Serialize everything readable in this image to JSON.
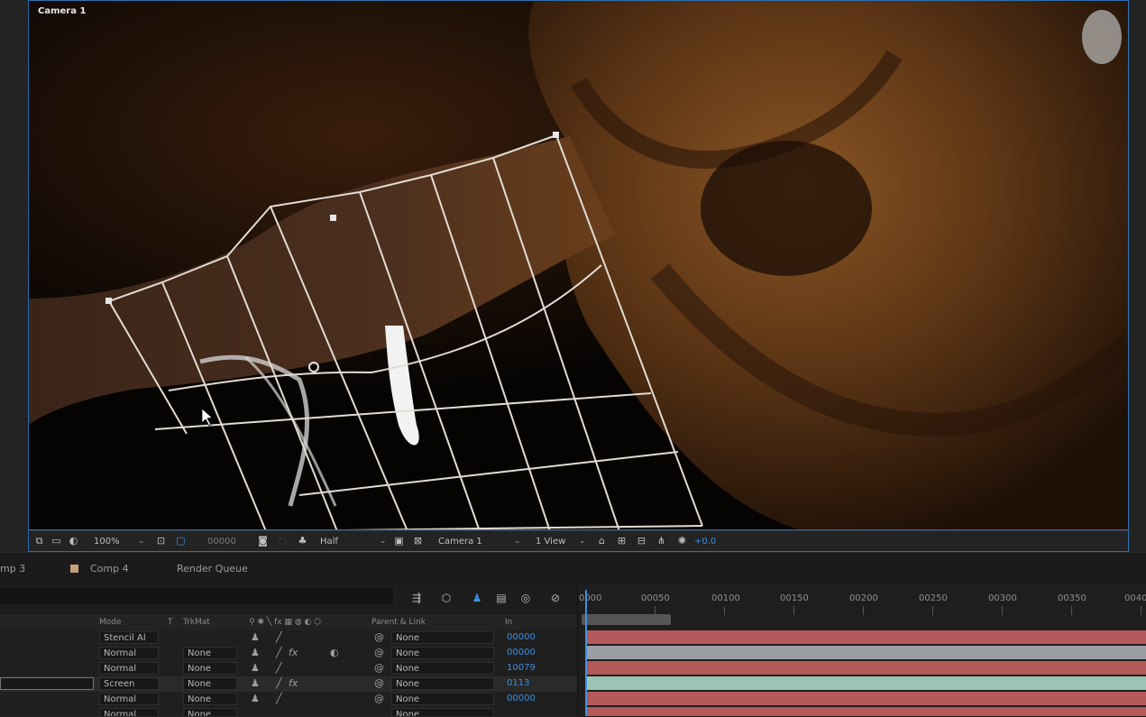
{
  "viewer": {
    "camera_label": "Camera 1",
    "zoom": "100%",
    "timecode": "00000",
    "resolution": "Half",
    "active_camera": "Camera 1",
    "view_layout": "1 View",
    "exposure": "+0.0"
  },
  "tabs": [
    {
      "label": "mp 3"
    },
    {
      "label": "Comp 4"
    },
    {
      "label": "Render Queue"
    }
  ],
  "columns": {
    "mode": "Mode",
    "t": "T",
    "trkmat": "TrkMat",
    "parent": "Parent & Link",
    "in": "In"
  },
  "layers": [
    {
      "mode": "Stencil Al",
      "trkmat": "",
      "parent": "None",
      "in": "00000",
      "fx": false
    },
    {
      "mode": "Normal",
      "trkmat": "None",
      "parent": "None",
      "in": "00000",
      "fx": true
    },
    {
      "mode": "Normal",
      "trkmat": "None",
      "parent": "None",
      "in": "10079",
      "fx": false
    },
    {
      "mode": "Screen",
      "trkmat": "None",
      "parent": "None",
      "in": "0113",
      "fx": true
    },
    {
      "mode": "Normal",
      "trkmat": "None",
      "parent": "None",
      "in": "00000",
      "fx": false
    },
    {
      "mode": "Normal",
      "trkmat": "None",
      "parent": "None",
      "in": "",
      "fx": false
    }
  ],
  "ruler": [
    "0000",
    "00050",
    "00100",
    "00150",
    "00200",
    "00250",
    "00300",
    "00350",
    "0040"
  ],
  "bar_colors": [
    "#b45a5a",
    "#9c9ca4",
    "#b45a5a",
    "#9cc4b4",
    "#b45a5a",
    "#b45a5a"
  ],
  "accent": "#2e6fb0"
}
